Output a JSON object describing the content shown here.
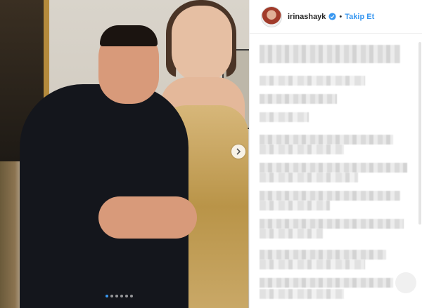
{
  "post": {
    "username": "irinashayk",
    "separator": "•",
    "follow_label": "Takip Et",
    "verified": true,
    "icons": {
      "verified": "verified-badge-icon",
      "carousel_next": "chevron-right-icon"
    },
    "colors": {
      "accent": "#3897f0",
      "username": "#262626",
      "border": "#efefef"
    },
    "carousel": {
      "dot_count": 6,
      "active_index": 0
    }
  }
}
